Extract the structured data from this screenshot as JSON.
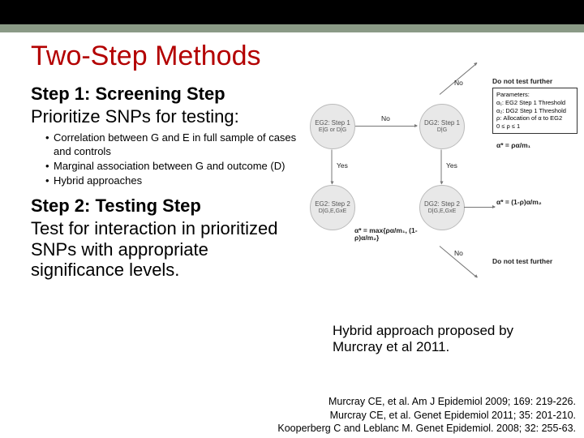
{
  "title": "Two-Step Methods",
  "step1": {
    "heading": "Step 1: Screening Step",
    "lead": "Prioritize SNPs for testing:",
    "bullets": [
      "Correlation between G and E in full sample of cases and controls",
      "Marginal association between G and outcome (D)",
      "Hybrid approaches"
    ]
  },
  "step2": {
    "heading": "Step 2: Testing Step",
    "lead": "Test for interaction in prioritized SNPs with appropriate significance levels."
  },
  "diagram": {
    "c1": "EG2: Step 1",
    "c1b": "E|G or D|G",
    "c2": "DG2: Step 1",
    "c2b": "D|G",
    "c3": "EG2: Step 2",
    "c3b": "D|G,E,GxE",
    "c4": "DG2: Step 2",
    "c4b": "D|G,E,GxE",
    "yes1": "Yes",
    "no1": "No",
    "yes2": "Yes",
    "no2": "No",
    "dnt1": "Do not test further",
    "dnt2": "Do not test further",
    "alpha1": "α* = ρα/m₁",
    "alpha2": "α* = (1-ρ)α/m₂",
    "alpha3": "α* = max{ρα/m₁, (1-ρ)α/m₂}",
    "params": {
      "l1": "Parameters:",
      "l2": "α₁: EG2 Step 1 Threshold",
      "l3": "α₂: DG2 Step 1 Threshold",
      "l4": "ρ: Allocation of α to EG2",
      "l5": "0 ≤ ρ ≤ 1"
    }
  },
  "caption": "Hybrid approach proposed by Murcray et al 2011.",
  "refs": [
    "Murcray CE,  et al. Am J Epidemiol 2009; 169: 219-226.",
    "Murcray CE,  et al. Genet Epidemiol 2011; 35: 201-210.",
    "Kooperberg C and Leblanc M. Genet Epidemiol. 2008; 32: 255-63."
  ]
}
